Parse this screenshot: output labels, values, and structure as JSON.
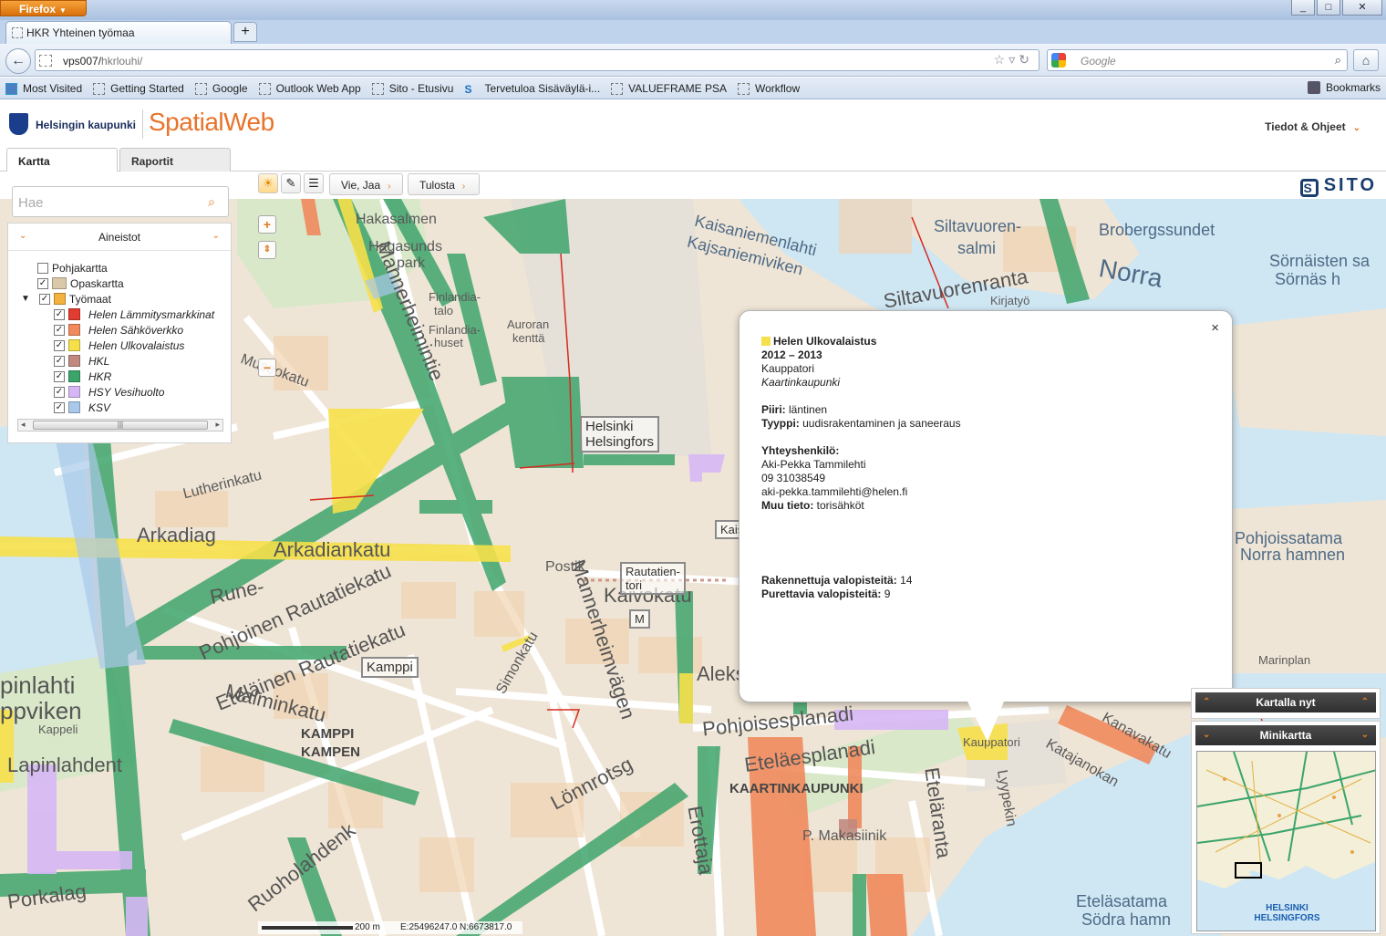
{
  "browser": {
    "button": "Firefox",
    "window_controls": [
      "_",
      "□",
      "✕"
    ],
    "tab_title": "HKR Yhteinen työmaa",
    "new_tab": "+",
    "url_host": "vps007/",
    "url_path": "hkrlouhi/",
    "search_placeholder": "Google",
    "bookmarks": [
      "Most Visited",
      "Getting Started",
      "Google",
      "Outlook Web App",
      "Sito - Etusivu",
      "Tervetuloa Sisäväylä-i...",
      "VALUEFRAME PSA",
      "Workflow"
    ],
    "bookmarks_menu": "Bookmarks"
  },
  "app": {
    "city": "Helsingin kaupunki",
    "name": "SpatialWeb",
    "help": "Tiedot & Ohjeet",
    "tabs": [
      "Kartta",
      "Raportit"
    ],
    "toolbar": {
      "share": "Vie, Jaa",
      "print": "Tulosta"
    },
    "brand": "SITO"
  },
  "search": {
    "placeholder": "Hae"
  },
  "layers": {
    "title": "Aineistot",
    "items": [
      {
        "label": "Pohjakartta",
        "checked": false,
        "italic": false,
        "color": ""
      },
      {
        "label": "Opaskartta",
        "checked": true,
        "italic": false,
        "color": ""
      },
      {
        "label": "Työmaat",
        "checked": true,
        "italic": false,
        "color": "#f3b13d"
      },
      {
        "label": "Helen Lämmitysmarkkinat",
        "checked": true,
        "italic": true,
        "color": "#e23b2f"
      },
      {
        "label": "Helen Sähköverkko",
        "checked": true,
        "italic": true,
        "color": "#f08a5d"
      },
      {
        "label": "Helen Ulkovalaistus",
        "checked": true,
        "italic": true,
        "color": "#f6e04a"
      },
      {
        "label": "HKL",
        "checked": true,
        "italic": true,
        "color": "#c08a80"
      },
      {
        "label": "HKR",
        "checked": true,
        "italic": true,
        "color": "#3aa46a"
      },
      {
        "label": "HSY Vesihuolto",
        "checked": true,
        "italic": true,
        "color": "#d6b7f5"
      },
      {
        "label": "KSV",
        "checked": true,
        "italic": true,
        "color": "#aac9ea"
      }
    ]
  },
  "popup": {
    "title": "Helen Ulkovalaistus",
    "years": "2012 – 2013",
    "place": "Kauppatori",
    "district": "Kaartinkaupunki",
    "piiri_label": "Piiri:",
    "piiri": "läntinen",
    "tyyppi_label": "Tyyppi:",
    "tyyppi": "uudisrakentaminen ja saneeraus",
    "contact_label": "Yhteyshenkilö:",
    "contact_name": "Aki-Pekka Tammilehti",
    "contact_phone": "09 31038549",
    "contact_email": "aki-pekka.tammilehti@helen.fi",
    "other_label": "Muu tieto:",
    "other": "torisähköt",
    "built_label": "Rakennettuja valopisteitä:",
    "built": "14",
    "removed_label": "Purettavia valopisteitä:",
    "removed": "9",
    "close": "×"
  },
  "panels": {
    "now": "Kartalla nyt",
    "minimap": "Minikartta",
    "minimap_label_1": "HELSINKI",
    "minimap_label_2": "HELSINGFORS"
  },
  "scale": {
    "label": "200 m",
    "coords": "E:25496247.0 N:6673817.0"
  },
  "map_labels": {
    "hakasalmen": "Hakasalmen",
    "park": "park",
    "hagasunds": "Hagasunds",
    "finlandia": "Finlandia-",
    "talo": "talo",
    "finlandia_huset": "Finlandia-",
    "huset": "huset",
    "auroran": "Auroran",
    "kentta": "kenttä",
    "helsinki_hel": "Helsinki",
    "helsingfors": "Helsingfors",
    "kaisaniemenlahti": "Kaisaniemenlahti",
    "kaisaniemiviken": "Kajsaniemiviken",
    "siltavuoren": "Siltavuoren-",
    "salmi": "salmi",
    "broberg": "Brobergssundet",
    "norra": "Norra",
    "sornaisten": "Sörnäisten sa",
    "sornas": "Sörnäs h",
    "siltavuorenranta": "Siltavuorenranta",
    "kirjatyo": "Kirjatyö",
    "museokatu": "Museokatu",
    "lutherinkatu": "Lutherinkatu",
    "arkadiag": "Arkadiag",
    "arkadiankatu": "Arkadiankatu",
    "runeberg": "Rune-",
    "mannerheimintie": "Mannerheimintie",
    "mannerheimvagen": "Mannerheimvägen",
    "kaivokatu": "Kaivokatu",
    "rautatientori": "Rautatien-",
    "tori": "tori",
    "postik": "Postik",
    "kamppi": "Kamppi",
    "kamppi_big": "KAMPPI",
    "kampen": "KAMPEN",
    "simonkatu": "Simonkatu",
    "eteläinen_rautatiekatu": "Eteläinen Rautatiekatu",
    "pohjoinen_rautatiekatu": "Pohjoinen Rautatiekatu",
    "malminkatu": "Malminkatu",
    "lonnrotsg": "Lönnrotsg",
    "pohjoisesplanadi": "Pohjoisesplanadi",
    "etelaesplanadi": "Eteläesplanadi",
    "kaartinkaupunki": "KAARTINKAUPUNKI",
    "etelaranta": "Eteläranta",
    "pohjoissatama": "Pohjoissatama",
    "norra_hamnen": "Norra hamnen",
    "kauppatori_map": "Kauppatori",
    "lapinlahdent": "Lapinlahdent",
    "lapinlahti": "pinlahti",
    "lappviken": "ppviken",
    "kappeli": "Kappeli",
    "porkalag": "Porkalag",
    "ruoholahdenk": "Ruoholahdenk",
    "erottaja": "Erottaja",
    "aleks": "Aleks",
    "eteläsatama": "Eteläsatama",
    "sodra_hamnen": "Södra hamn",
    "katajanokan": "Katajanokan",
    "marinplan": "Marinplan",
    "kanavakatu": "Kanavakatu",
    "kaisan": "Kaisa",
    "makasiinik": "P. Makasiinik",
    "lyypekin": "Lyypekin",
    "helsinki_m": "M"
  }
}
